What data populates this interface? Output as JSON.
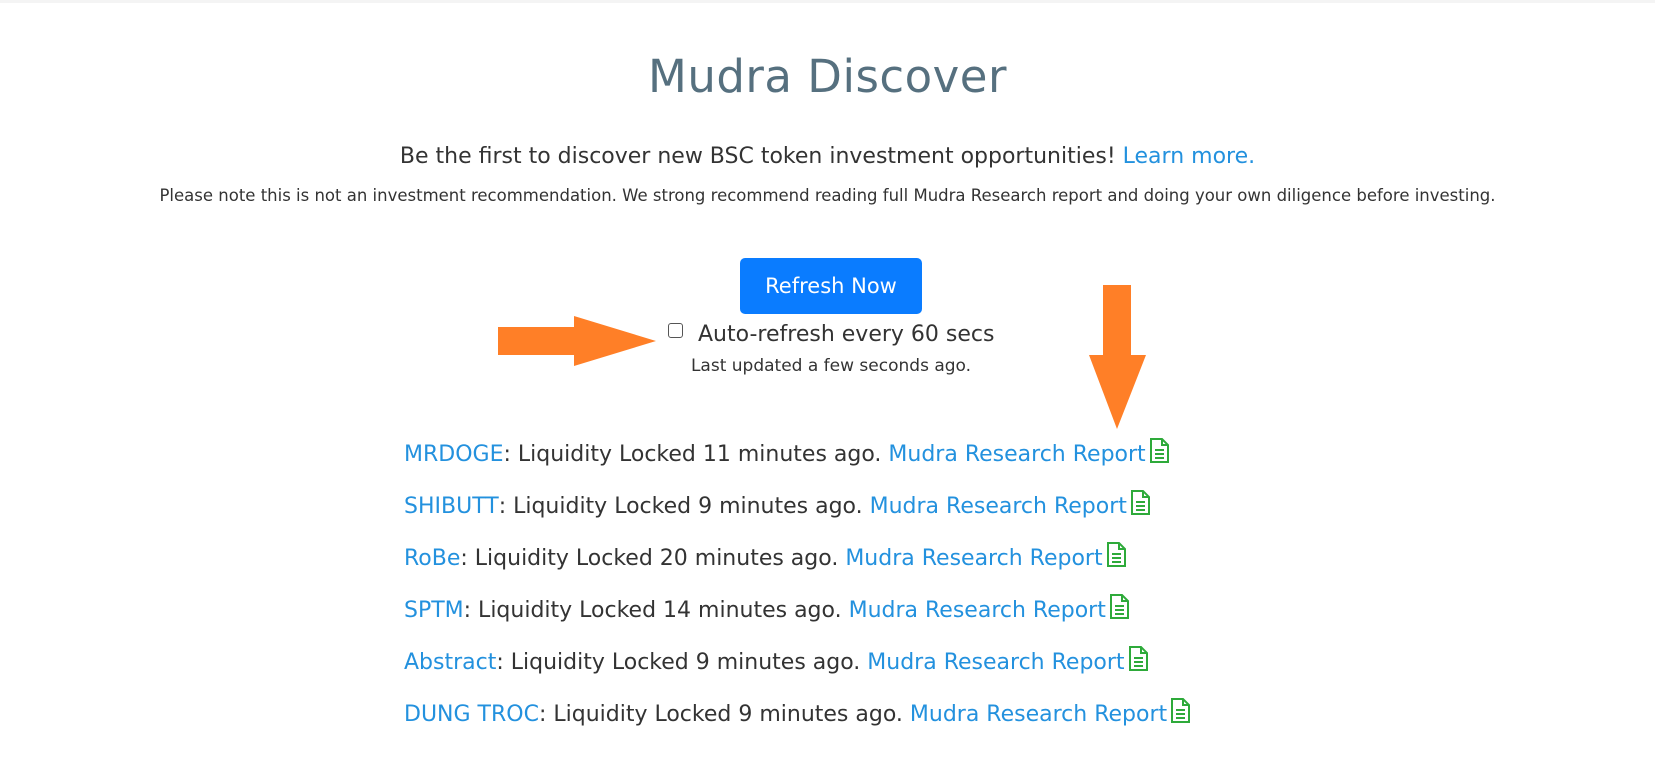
{
  "header": {
    "title": "Mudra Discover",
    "tagline": "Be the first to discover new BSC token investment opportunities!",
    "learn_more": "Learn more.",
    "disclaimer": "Please note this is not an investment recommendation. We strong recommend reading full Mudra Research report and doing your own diligence before investing."
  },
  "controls": {
    "refresh_label": "Refresh Now",
    "autorefresh_label": "Auto-refresh every 60 secs",
    "autorefresh_checked": false,
    "last_updated": "Last updated a few seconds ago."
  },
  "colors": {
    "accent": "#0a7cff",
    "link": "#2391de",
    "icon": "#2eaa3a",
    "arrow": "#ff7f27",
    "title": "#56707f"
  },
  "icons": {
    "report": "file-text-icon",
    "pointer": "arrow-icon"
  },
  "tokens": [
    {
      "name": "MRDOGE",
      "status": ": Liquidity Locked 11 minutes ago. ",
      "report": "Mudra Research Report"
    },
    {
      "name": "SHIBUTT",
      "status": ": Liquidity Locked 9 minutes ago. ",
      "report": "Mudra Research Report"
    },
    {
      "name": "RoBe",
      "status": ": Liquidity Locked 20 minutes ago. ",
      "report": "Mudra Research Report"
    },
    {
      "name": "SPTM",
      "status": ": Liquidity Locked 14 minutes ago. ",
      "report": "Mudra Research Report"
    },
    {
      "name": "Abstract",
      "status": ": Liquidity Locked 9 minutes ago. ",
      "report": "Mudra Research Report"
    },
    {
      "name": "DUNG TROC",
      "status": ": Liquidity Locked 9 minutes ago. ",
      "report": "Mudra Research Report"
    }
  ]
}
